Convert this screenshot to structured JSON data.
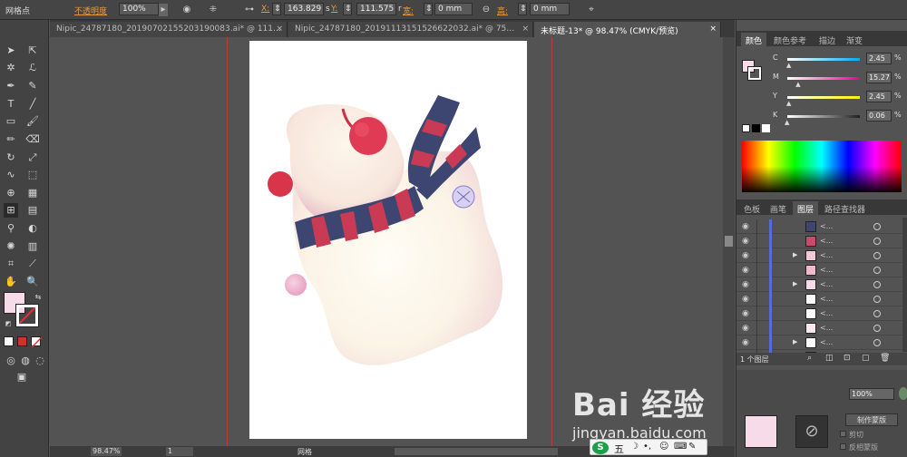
{
  "control": {
    "mode": "网格点",
    "opacity_label": "不透明度",
    "opacity_value": "100%",
    "x_label": "X:",
    "x_value": "163.829",
    "x_unit": "s",
    "y_label": "Y:",
    "y_value": "111.575",
    "y_unit": "r",
    "w_label": "宽:",
    "w_value": "0 mm",
    "h_label": "高:",
    "h_value": "0 mm"
  },
  "tabs": [
    {
      "label": "Nipic_24787180_20190702155203190083.ai* @ 111…",
      "close": "×"
    },
    {
      "label": "Nipic_24787180_20191113151526622032.ai* @ 75…",
      "close": "×"
    },
    {
      "label": "未标题-13* @ 98.47% (CMYK/预览)",
      "close": "×"
    }
  ],
  "status": {
    "zoom": "98.47%",
    "page": "1",
    "tool": "网格"
  },
  "color_panel": {
    "tabs": [
      "颜色",
      "颜色参考",
      "描边",
      "渐变"
    ],
    "channels": [
      {
        "name": "C",
        "value": "2.45",
        "unit": "%",
        "color": "#00aeef"
      },
      {
        "name": "M",
        "value": "15.27",
        "unit": "%",
        "color": "#ec008c"
      },
      {
        "name": "Y",
        "value": "2.45",
        "unit": "%",
        "color": "#fff200"
      },
      {
        "name": "K",
        "value": "0.06",
        "unit": "%",
        "color": "#231f20"
      }
    ],
    "fill_color": "#f7dbe8"
  },
  "layers_panel": {
    "tabs": [
      "色板",
      "画笔",
      "图层",
      "路径查找器"
    ],
    "rows": [
      {
        "name": "<...",
        "expand": "",
        "thumb": "#3d4670"
      },
      {
        "name": "<...",
        "expand": "",
        "thumb": "#c94a6a"
      },
      {
        "name": "<...",
        "expand": "▶",
        "thumb": "#f3c9d8"
      },
      {
        "name": "<...",
        "expand": "",
        "thumb": "#f0b9cd"
      },
      {
        "name": "<...",
        "expand": "▶",
        "thumb": "#f7dbe8"
      },
      {
        "name": "<...",
        "expand": "",
        "thumb": "#ffffff"
      },
      {
        "name": "<...",
        "expand": "",
        "thumb": "#ffffff"
      },
      {
        "name": "<...",
        "expand": "",
        "thumb": "#fbe8ef"
      },
      {
        "name": "<...",
        "expand": "▶",
        "thumb": "#ffffff"
      },
      {
        "name": "<...",
        "expand": "",
        "thumb": "#ffffff"
      }
    ],
    "footer": "1 个图层"
  },
  "transparency_panel": {
    "opacity": "100%",
    "make_mask": "制作蒙版",
    "clip": "剪切",
    "invert": "反相蒙版"
  },
  "watermark": {
    "text": "Bai 经验",
    "url": "jingyan.baidu.com"
  },
  "taskbar": {
    "ime": "五"
  }
}
